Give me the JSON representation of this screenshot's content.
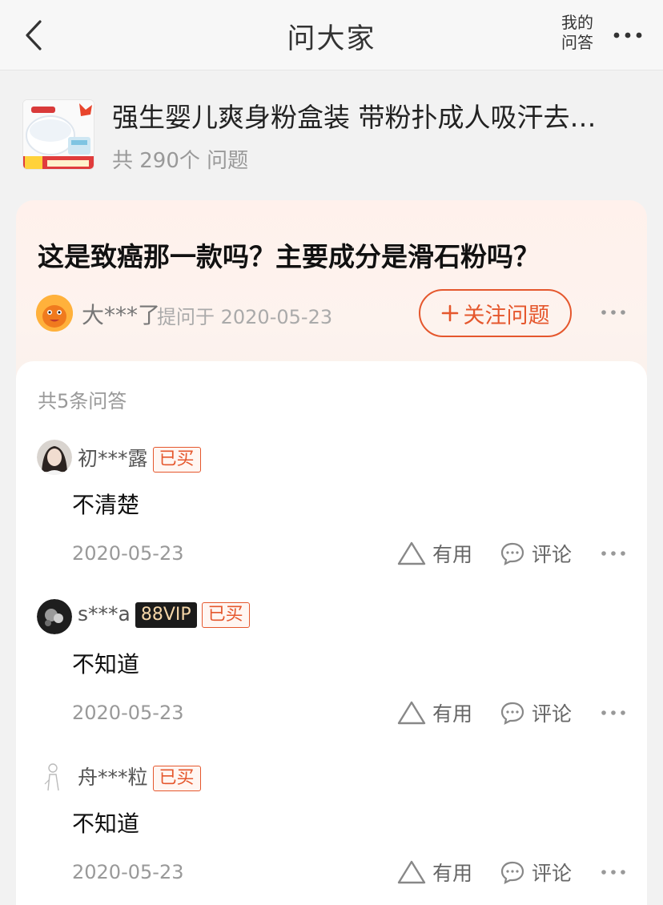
{
  "nav": {
    "title": "问大家",
    "my_answers_line1": "我的",
    "my_answers_line2": "问答"
  },
  "product": {
    "name": "强生婴儿爽身粉盒装 带粉扑成人吸汗去…",
    "question_count": "共 290个 问题"
  },
  "question": {
    "text": "这是致癌那一款吗？主要成分是滑石粉吗？",
    "user": "大***了",
    "meta": "提问于 2020-05-23",
    "follow_label": "关注问题"
  },
  "answers": {
    "count_label": "共5条问答",
    "useful_label": "有用",
    "comment_label": "评论",
    "items": [
      {
        "user": "初***露",
        "vip": "",
        "badge": "已买",
        "text": "不清楚",
        "date": "2020-05-23"
      },
      {
        "user": "s***a",
        "vip": "88VIP",
        "badge": "已买",
        "text": "不知道",
        "date": "2020-05-23"
      },
      {
        "user": "舟***粒",
        "vip": "",
        "badge": "已买",
        "text": "不知道",
        "date": "2020-05-23"
      }
    ]
  },
  "colors": {
    "accent": "#e5572d",
    "question_bg": "#fff1ec",
    "vip_bg": "#1b1b1b"
  },
  "icons": [
    "back-arrow-icon",
    "more-dots-icon",
    "plus-icon",
    "triangle-useful-icon",
    "comment-bubble-icon"
  ]
}
